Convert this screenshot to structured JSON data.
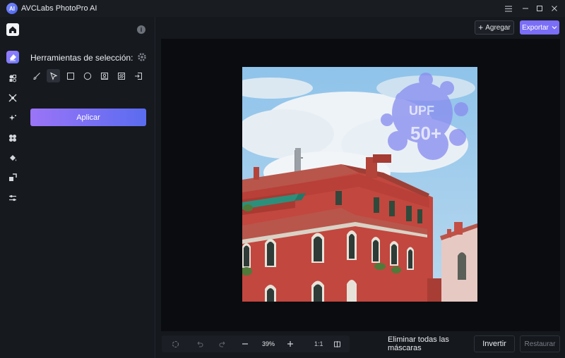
{
  "titlebar": {
    "logo_text": "AI",
    "title": "AVCLabs PhotoPro AI",
    "menu_icon": "hamburger-icon",
    "minimize_icon": "minimize-icon",
    "maximize_icon": "maximize-icon",
    "close_icon": "close-icon"
  },
  "rail": {
    "items": [
      {
        "name": "home",
        "icon": "home-icon"
      },
      {
        "name": "object-remover",
        "icon": "eraser-icon"
      },
      {
        "name": "replace",
        "icon": "shapes-icon"
      },
      {
        "name": "upscale",
        "icon": "expand-icon"
      },
      {
        "name": "denoise",
        "icon": "sparkle-icon"
      },
      {
        "name": "colorize",
        "icon": "fan-icon"
      },
      {
        "name": "fill",
        "icon": "bucket-icon"
      },
      {
        "name": "resize",
        "icon": "resize-icon"
      },
      {
        "name": "adjust",
        "icon": "sliders-icon"
      }
    ]
  },
  "panel": {
    "info_label": "i",
    "heading": "Herramientas de selección:",
    "tools": [
      {
        "name": "brush-tool",
        "icon": "brush-icon"
      },
      {
        "name": "pointer-tool",
        "icon": "pointer-icon",
        "selected": true
      },
      {
        "name": "rectangle-tool",
        "icon": "rectangle-icon"
      },
      {
        "name": "ellipse-tool",
        "icon": "ellipse-icon"
      },
      {
        "name": "portrait-tool",
        "icon": "portrait-icon"
      },
      {
        "name": "pattern-tool",
        "icon": "pattern-icon"
      },
      {
        "name": "import-tool",
        "icon": "import-icon"
      }
    ],
    "apply_label": "Aplicar"
  },
  "header": {
    "add_label": "Agregar",
    "export_label": "Exportar"
  },
  "canvas": {
    "image_description_watermark": "UPF 50+"
  },
  "bottom": {
    "zoom": "39%",
    "ratio": "1:1",
    "remove_all_label": "Eliminar todas las máscaras",
    "invert_label": "Invertir",
    "restore_label": "Restaurar"
  },
  "colors": {
    "accent": "#7b6ef6",
    "apply_gradient_start": "#9b74f7",
    "apply_gradient_end": "#5a6cf0"
  }
}
